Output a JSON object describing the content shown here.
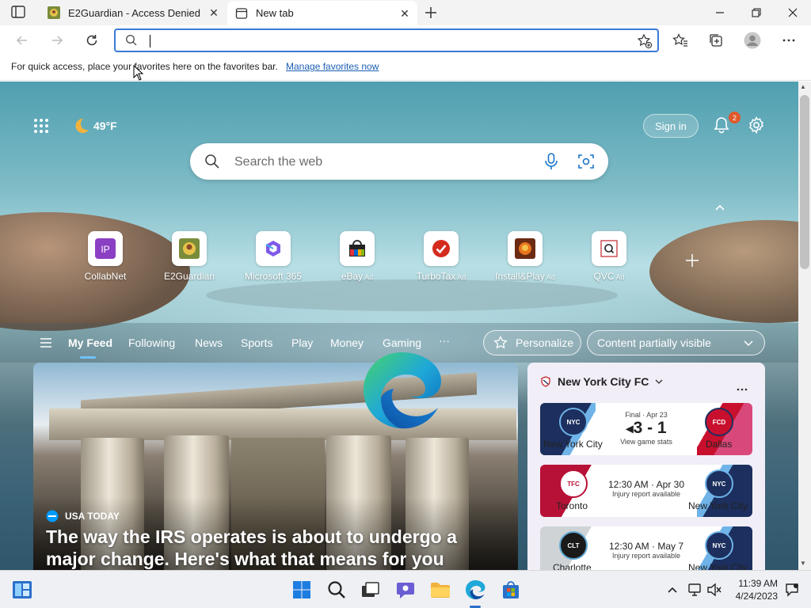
{
  "tabs": [
    {
      "title": "E2Guardian - Access Denied",
      "active": false
    },
    {
      "title": "New tab",
      "active": true
    }
  ],
  "toolbar": {
    "address_value": "",
    "address_placeholder": ""
  },
  "favorites_bar": {
    "message": "For quick access, place your favorites here on the favorites bar.",
    "link": "Manage favorites now"
  },
  "ntp": {
    "weather": "49°F",
    "sign_in": "Sign in",
    "notification_count": "2",
    "search_placeholder": "Search the web",
    "quick_links": [
      {
        "label": "CollabNet",
        "ad": ""
      },
      {
        "label": "E2Guardian",
        "ad": ""
      },
      {
        "label": "Microsoft 365",
        "ad": ""
      },
      {
        "label": "eBay",
        "ad": "Ad"
      },
      {
        "label": "TurboTax",
        "ad": "Ad"
      },
      {
        "label": "Install&Play",
        "ad": "Ad"
      },
      {
        "label": "QVC",
        "ad": "Ad"
      }
    ],
    "feed_nav": [
      "My Feed",
      "Following",
      "News",
      "Sports",
      "Play",
      "Money",
      "Gaming",
      "···"
    ],
    "personalize": "Personalize",
    "content_visibility": "Content partially visible",
    "hero": {
      "source": "USA TODAY",
      "title": "The way the IRS operates is about to undergo a major change. Here's what that means for you"
    },
    "sports": {
      "team": "New York City FC",
      "matches": [
        {
          "home": "New York City",
          "away": "Dallas",
          "status": "Final · Apr 23",
          "score": "3 - 1",
          "note": "View game stats",
          "home_color": "#1c2f5e",
          "away_color": "#c8102e"
        },
        {
          "home": "Toronto",
          "away": "New York City",
          "status": "12:30 AM · Apr 30",
          "score": "",
          "note": "Injury report available",
          "home_color": "#b81137",
          "away_color": "#1c2f5e"
        },
        {
          "home": "Charlotte",
          "away": "New York City",
          "status": "12:30 AM · May 7",
          "score": "",
          "note": "Injury report available",
          "home_color": "#1a1a1a",
          "away_color": "#1c2f5e"
        }
      ]
    }
  },
  "taskbar": {
    "time": "11:39 AM",
    "date": "4/24/2023"
  }
}
